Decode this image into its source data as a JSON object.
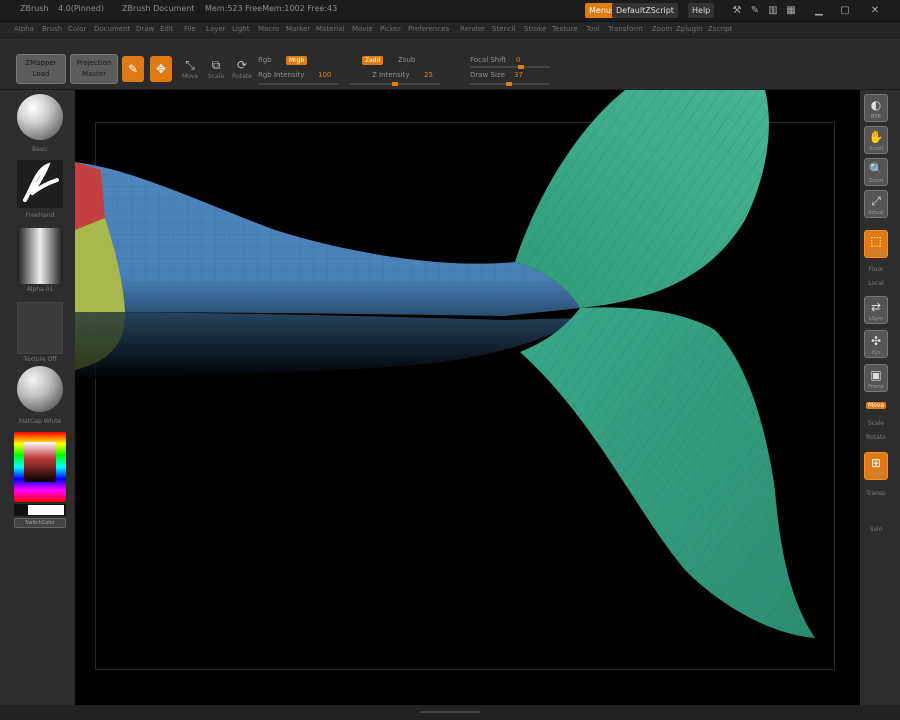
{
  "titlebar": {
    "app": "ZBrush",
    "version": "4.0(Pinned)",
    "document": "ZBrush Document",
    "stats": "Mem:523 FreeMem:1002 Free:43",
    "quicksave": "Menus",
    "default_script": "DefaultZScript",
    "help": "Help"
  },
  "menubar": {
    "items": [
      "Alpha",
      "Brush",
      "Color",
      "Document",
      "Draw",
      "Edit",
      "File",
      "Layer",
      "Light",
      "Macro",
      "Marker",
      "Material",
      "Movie",
      "Picker",
      "Preferences",
      "Render",
      "Stencil",
      "Stroke",
      "Texture",
      "Tool",
      "Transform",
      "Zoom",
      "Zplugin",
      "Zscript"
    ]
  },
  "toolbar": {
    "clip_button": "ZMapper",
    "clip_sub": "Load",
    "projection_button": "Projection",
    "projection_sub": "Master",
    "edit_icon": "edit-icon",
    "draw_icon": "draw-icon",
    "move_label": "Move",
    "scale_label": "Scale",
    "rotate_label": "Rotate",
    "rgb_label": "Rgb",
    "mrgb_label": "Mrgb",
    "rgb_intensity_label": "Rgb Intensity",
    "rgb_intensity_value": "100",
    "zadd_label": "Zadd",
    "zsub_label": "Zsub",
    "z_intensity_label": "Z Intensity",
    "z_intensity_value": "25",
    "focal_shift_label": "Focal Shift",
    "focal_shift_value": "0",
    "draw_size_label": "Draw Size",
    "draw_size_value": "37"
  },
  "left_shelf": {
    "brush_label": "Basic",
    "stroke_label": "FreeHand",
    "alpha_label": "Alpha 01",
    "texture_label": "Texture Off",
    "material_label": "MatCap White",
    "switch_label": "SwitchColor"
  },
  "right_shelf": {
    "buttons": [
      "BPR",
      "Scroll",
      "Zoom",
      "Actual",
      "Persp",
      "Floor",
      "Local",
      "LSym",
      "Xyz",
      "Frame",
      "Move",
      "Scale",
      "Rotate",
      "PolyF",
      "Transp",
      "Solo"
    ]
  },
  "viewport": {
    "model": "fish-tail-mesh"
  },
  "colors": {
    "accent": "#e07a12",
    "tail_body": "#4a7fb8",
    "fin": "#3aa88a",
    "red_patch": "#c24040",
    "yellow_patch": "#a8b84a"
  }
}
